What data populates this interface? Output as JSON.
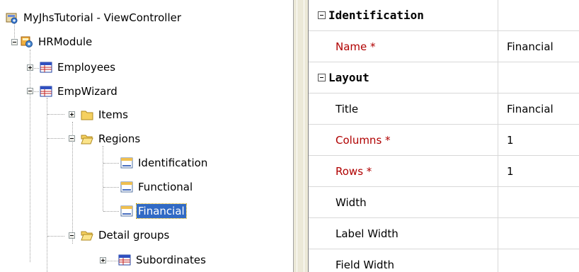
{
  "tree": {
    "root": "MyJhsTutorial - ViewController",
    "module": "HRModule",
    "employees": "Employees",
    "empwizard": "EmpWizard",
    "items": "Items",
    "regions": "Regions",
    "identification": "Identification",
    "functional": "Functional",
    "financial": "Financial",
    "detail_groups": "Detail groups",
    "subordinates": "Subordinates",
    "selected": "Financial"
  },
  "properties": {
    "cat_identification": "Identification",
    "name_label": "Name *",
    "name_value": "Financial",
    "cat_layout": "Layout",
    "title_label": "Title",
    "title_value": "Financial",
    "columns_label": "Columns *",
    "columns_value": "1",
    "rows_label": "Rows *",
    "rows_value": "1",
    "width_label": "Width",
    "width_value": "",
    "label_width_label": "Label Width",
    "label_width_value": "",
    "field_width_label": "Field Width"
  },
  "colors": {
    "required_text": "#b00000",
    "selection_bg": "#316ac5",
    "panel_bg": "#ece9d8"
  }
}
